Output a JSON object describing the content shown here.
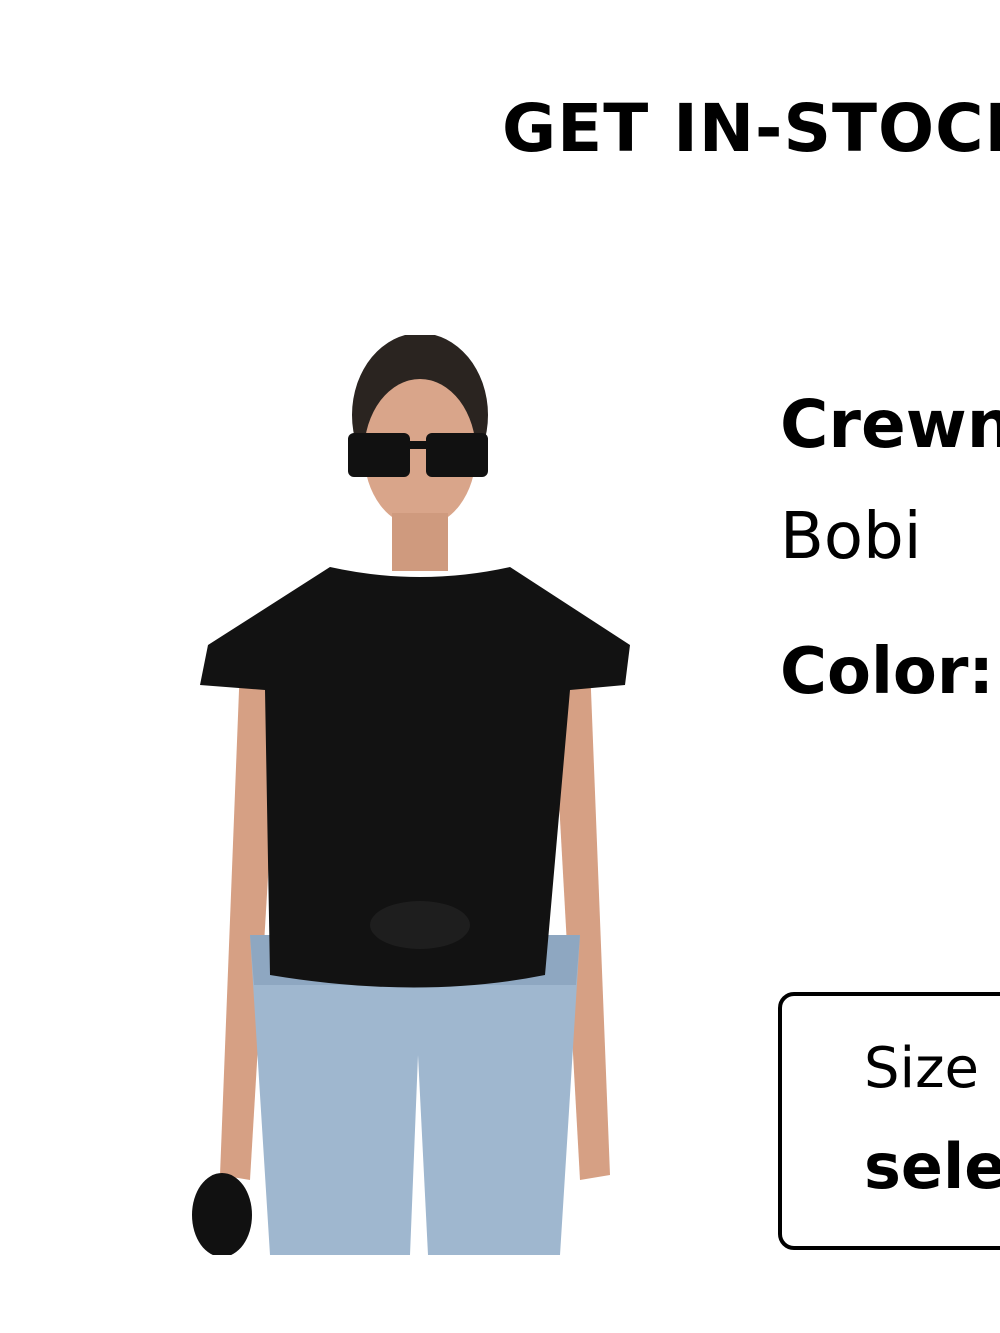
{
  "header": {
    "title": "GET IN-STOCK"
  },
  "product": {
    "name": "Crewneck",
    "brand": "Bobi",
    "color_label": "Color:",
    "image_icon": "product-photo"
  },
  "size_selector": {
    "label": "Size",
    "value": "select"
  },
  "colors": {
    "text": "#000000",
    "background": "#ffffff",
    "border": "#000000"
  }
}
